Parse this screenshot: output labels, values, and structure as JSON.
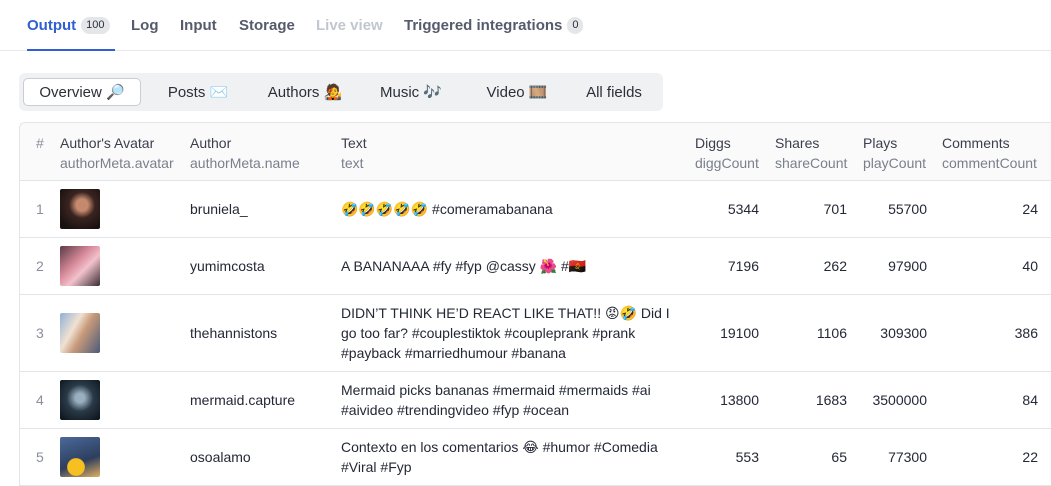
{
  "tabs": [
    {
      "label": "Output",
      "badge": "100"
    },
    {
      "label": "Log"
    },
    {
      "label": "Input"
    },
    {
      "label": "Storage"
    },
    {
      "label": "Live view"
    },
    {
      "label": "Triggered integrations",
      "badge": "0"
    }
  ],
  "views": [
    "Overview 🔎",
    "Posts ✉️",
    "Authors 🧑‍🎤",
    "Music 🎶",
    "Video 🎞️",
    "All fields"
  ],
  "columns": {
    "index": "#",
    "avatar": {
      "title": "Author's Avatar",
      "field": "authorMeta.avatar"
    },
    "author": {
      "title": "Author",
      "field": "authorMeta.name"
    },
    "text": {
      "title": "Text",
      "field": "text"
    },
    "diggs": {
      "title": "Diggs",
      "field": "diggCount"
    },
    "shares": {
      "title": "Shares",
      "field": "shareCount"
    },
    "plays": {
      "title": "Plays",
      "field": "playCount"
    },
    "comments": {
      "title": "Comments",
      "field": "commentCount"
    }
  },
  "rows": [
    {
      "index": "1",
      "author": "bruniela_",
      "text_lines": [
        "🤣🤣🤣🤣🤣 #comeramabanana"
      ],
      "diggs": "5344",
      "shares": "701",
      "plays": "55700",
      "comments": "24"
    },
    {
      "index": "2",
      "author": "yumimcosta",
      "text_lines": [
        "A BANANAAA #fy #fyp @cassy 🌺 #🇦🇴"
      ],
      "diggs": "7196",
      "shares": "262",
      "plays": "97900",
      "comments": "40"
    },
    {
      "index": "3",
      "author": "thehannistons",
      "text_lines": [
        "DIDN’T THINK HE’D REACT LIKE THAT!! 😡🤣 Did I",
        "go too far? #couplestiktok #coupleprank #prank",
        "#payback #marriedhumour #banana"
      ],
      "diggs": "19100",
      "shares": "1106",
      "plays": "309300",
      "comments": "386"
    },
    {
      "index": "4",
      "author": "mermaid.capture",
      "text_lines": [
        "Mermaid picks bananas #mermaid #mermaids #ai",
        "#aivideo #trendingvideo #fyp #ocean"
      ],
      "diggs": "13800",
      "shares": "1683",
      "plays": "3500000",
      "comments": "84"
    },
    {
      "index": "5",
      "author": "osoalamo",
      "text_lines": [
        "Contexto en los comentarios 😂 #humor #Comedia",
        "#Viral #Fyp"
      ],
      "diggs": "553",
      "shares": "65",
      "plays": "77300",
      "comments": "22"
    }
  ]
}
